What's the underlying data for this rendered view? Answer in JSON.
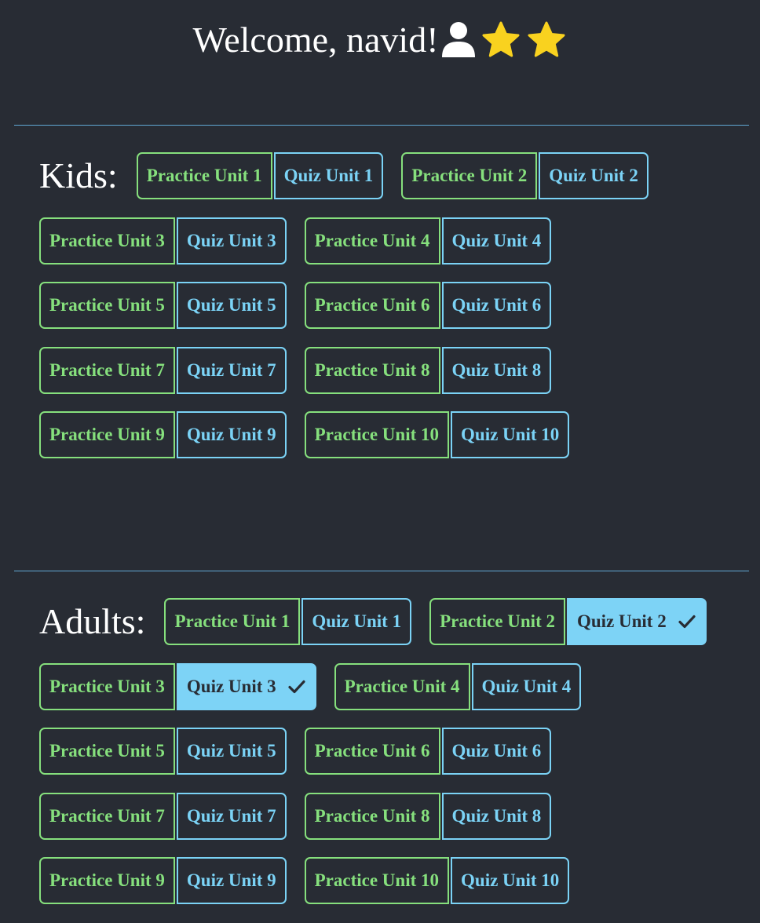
{
  "header": {
    "welcome_text": "Welcome, navid!",
    "icons": [
      "user-icon",
      "star-icon",
      "star-icon"
    ],
    "star_color": "#f9d21f"
  },
  "colors": {
    "background": "#282c34",
    "practice_accent": "#86e07d",
    "quiz_accent": "#7bd3f6",
    "divider": "#61a8d4"
  },
  "sections": [
    {
      "label": "Kids:",
      "units": [
        {
          "practice": "Practice Unit 1",
          "quiz": "Quiz Unit 1",
          "quiz_completed": false
        },
        {
          "practice": "Practice Unit 2",
          "quiz": "Quiz Unit 2",
          "quiz_completed": false
        },
        {
          "practice": "Practice Unit 3",
          "quiz": "Quiz Unit 3",
          "quiz_completed": false
        },
        {
          "practice": "Practice Unit 4",
          "quiz": "Quiz Unit 4",
          "quiz_completed": false
        },
        {
          "practice": "Practice Unit 5",
          "quiz": "Quiz Unit 5",
          "quiz_completed": false
        },
        {
          "practice": "Practice Unit 6",
          "quiz": "Quiz Unit 6",
          "quiz_completed": false
        },
        {
          "practice": "Practice Unit 7",
          "quiz": "Quiz Unit 7",
          "quiz_completed": false
        },
        {
          "practice": "Practice Unit 8",
          "quiz": "Quiz Unit 8",
          "quiz_completed": false
        },
        {
          "practice": "Practice Unit 9",
          "quiz": "Quiz Unit 9",
          "quiz_completed": false
        },
        {
          "practice": "Practice Unit 10",
          "quiz": "Quiz Unit 10",
          "quiz_completed": false
        }
      ]
    },
    {
      "label": "Adults:",
      "units": [
        {
          "practice": "Practice Unit 1",
          "quiz": "Quiz Unit 1",
          "quiz_completed": false
        },
        {
          "practice": "Practice Unit 2",
          "quiz": "Quiz Unit 2",
          "quiz_completed": true
        },
        {
          "practice": "Practice Unit 3",
          "quiz": "Quiz Unit 3",
          "quiz_completed": true
        },
        {
          "practice": "Practice Unit 4",
          "quiz": "Quiz Unit 4",
          "quiz_completed": false
        },
        {
          "practice": "Practice Unit 5",
          "quiz": "Quiz Unit 5",
          "quiz_completed": false
        },
        {
          "practice": "Practice Unit 6",
          "quiz": "Quiz Unit 6",
          "quiz_completed": false
        },
        {
          "practice": "Practice Unit 7",
          "quiz": "Quiz Unit 7",
          "quiz_completed": false
        },
        {
          "practice": "Practice Unit 8",
          "quiz": "Quiz Unit 8",
          "quiz_completed": false
        },
        {
          "practice": "Practice Unit 9",
          "quiz": "Quiz Unit 9",
          "quiz_completed": false
        },
        {
          "practice": "Practice Unit 10",
          "quiz": "Quiz Unit 10",
          "quiz_completed": false
        }
      ]
    }
  ]
}
